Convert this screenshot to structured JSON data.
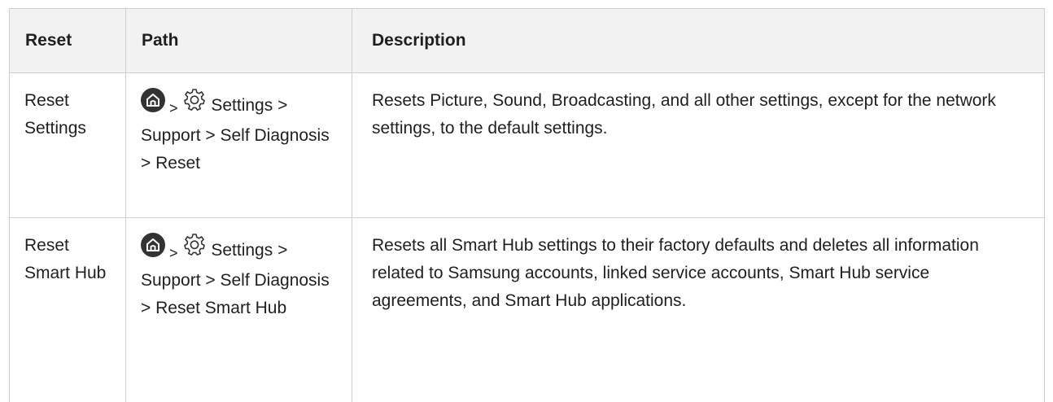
{
  "table": {
    "headers": [
      "Reset",
      "Path",
      "Description"
    ],
    "rows": [
      {
        "reset": "Reset Settings",
        "path_separator": ">",
        "path_rest": "Settings > Support > Self Diagnosis > Reset",
        "description": "Resets Picture, Sound, Broadcasting, and all other settings, except for the network settings, to the default settings."
      },
      {
        "reset": "Reset Smart Hub",
        "path_separator": ">",
        "path_rest": "Settings > Support > Self Diagnosis > Reset Smart Hub",
        "description": "Resets all Smart Hub settings to their factory defaults and deletes all information related to Samsung accounts, linked service accounts, Smart Hub service agreements, and Smart Hub applications."
      }
    ]
  },
  "icons": {
    "home": "home-icon",
    "settings": "gear-icon"
  },
  "colors": {
    "header_bg": "#f2f2f2",
    "border": "#cfcfcf",
    "text": "#1f1f1f",
    "icon_dark": "#333333"
  }
}
